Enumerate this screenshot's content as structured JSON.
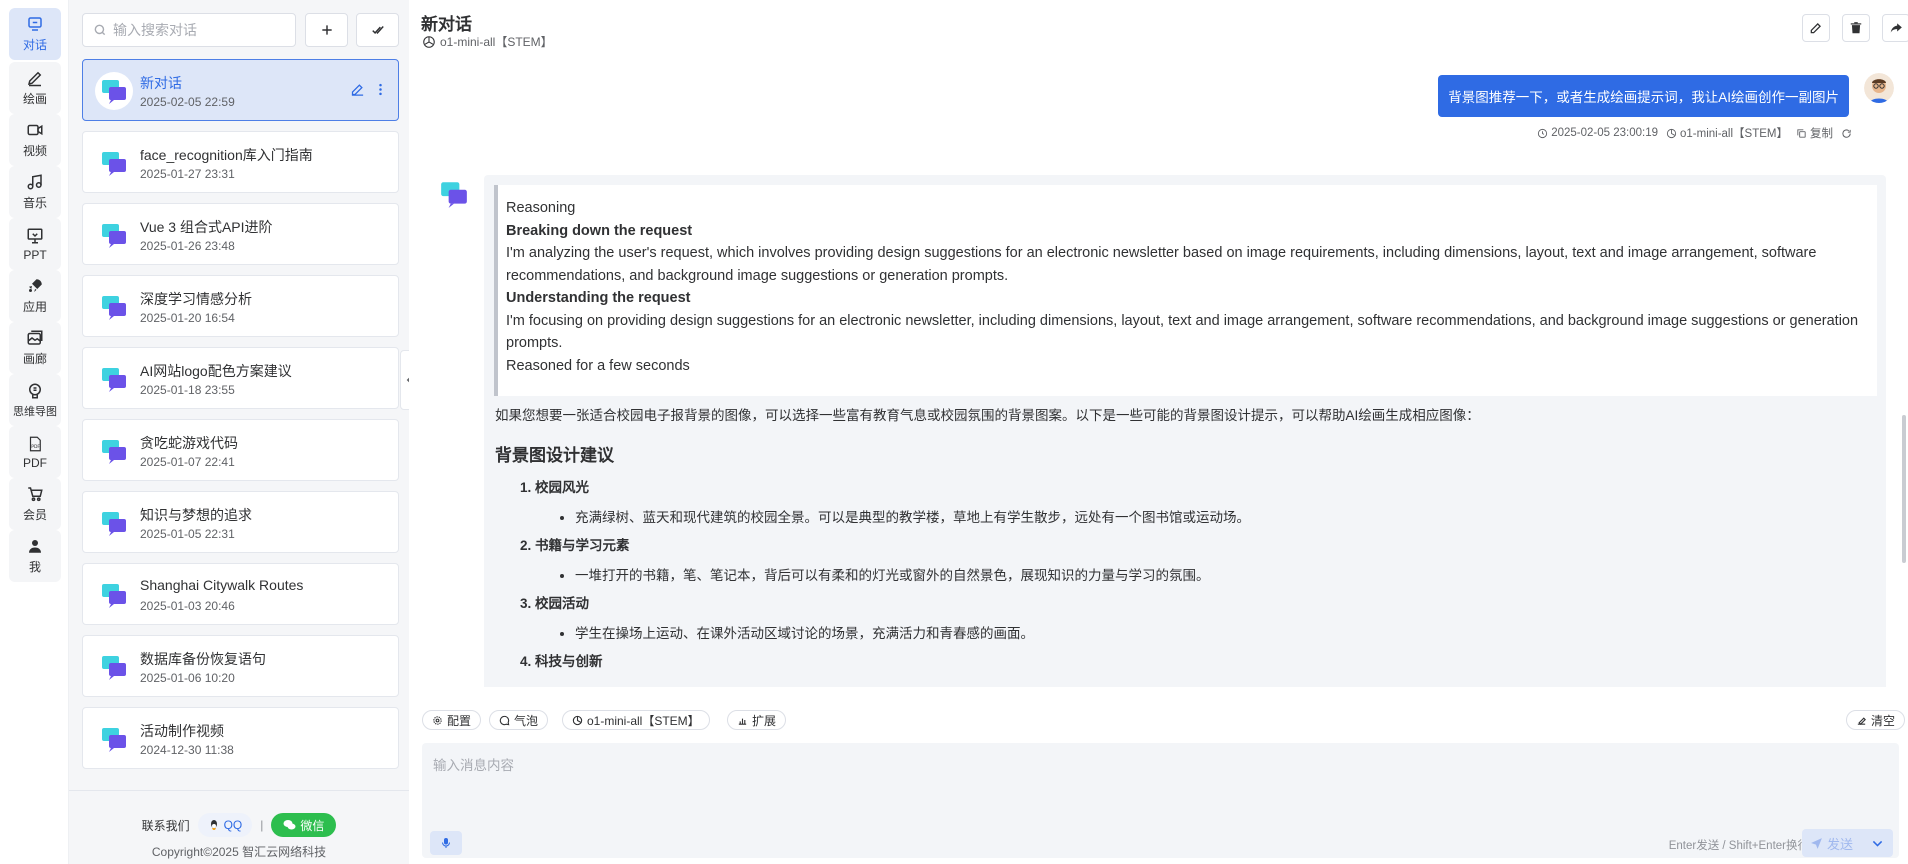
{
  "nav": [
    {
      "label": "对话",
      "icon": "chat-icon",
      "active": true
    },
    {
      "label": "绘画",
      "icon": "pen-icon"
    },
    {
      "label": "视频",
      "icon": "video-icon"
    },
    {
      "label": "音乐",
      "icon": "music-icon"
    },
    {
      "label": "PPT",
      "icon": "presentation-icon"
    },
    {
      "label": "应用",
      "icon": "rocket-icon"
    },
    {
      "label": "画廊",
      "icon": "gallery-icon"
    },
    {
      "label": "思维导图",
      "icon": "mindmap-icon"
    },
    {
      "label": "PDF",
      "icon": "pdf-icon"
    },
    {
      "label": "会员",
      "icon": "cart-icon"
    },
    {
      "label": "我",
      "icon": "user-icon"
    }
  ],
  "sidebar": {
    "search_placeholder": "输入搜索对话",
    "conversations": [
      {
        "title": "新对话",
        "date": "2025-02-05 22:59",
        "active": true
      },
      {
        "title": "face_recognition库入门指南",
        "date": "2025-01-27 23:31"
      },
      {
        "title": "Vue 3 组合式API进阶",
        "date": "2025-01-26 23:48"
      },
      {
        "title": "深度学习情感分析",
        "date": "2025-01-20 16:54"
      },
      {
        "title": "AI网站logo配色方案建议",
        "date": "2025-01-18 23:55"
      },
      {
        "title": "贪吃蛇游戏代码",
        "date": "2025-01-07 22:41"
      },
      {
        "title": "知识与梦想的追求",
        "date": "2025-01-05 22:31"
      },
      {
        "title": "Shanghai Citywalk Routes",
        "date": "2025-01-03 20:46"
      },
      {
        "title": "数据库备份恢复语句",
        "date": "2025-01-06 10:20"
      },
      {
        "title": "活动制作视频",
        "date": "2024-12-30 11:38"
      }
    ],
    "footer": {
      "contact_label": "联系我们",
      "qq_label": "QQ",
      "separator": "|",
      "wechat_label": "微信",
      "copyright": "Copyright©2025 智汇云网络科技"
    }
  },
  "header": {
    "title": "新对话",
    "model": "o1-mini-all【STEM】"
  },
  "messages": {
    "user": {
      "text": "背景图推荐一下，或者生成绘画提示词，我让AI绘画创作一副图片",
      "time": "2025-02-05 23:00:19",
      "model": "o1-mini-all【STEM】",
      "copy_label": "复制"
    },
    "bot": {
      "reasoning": {
        "label": "Reasoning",
        "h1": "Breaking down the request",
        "p1": "I'm analyzing the user's request, which involves providing design suggestions for an electronic newsletter based on image requirements, including dimensions, layout, text and image arrangement, software recommendations, and background image suggestions or generation prompts.",
        "h2": "Understanding the request",
        "p2": "I'm focusing on providing design suggestions for an electronic newsletter, including dimensions, layout, text and image arrangement, software recommendations, and background image suggestions or generation prompts.",
        "footer": "Reasoned for a few seconds"
      },
      "intro": "如果您想要一张适合校园电子报背景的图像，可以选择一些富有教育气息或校园氛围的背景图案。以下是一些可能的背景图设计提示，可以帮助AI绘画生成相应图像：",
      "heading": "背景图设计建议",
      "items": [
        {
          "title": "校园风光",
          "detail": "充满绿树、蓝天和现代建筑的校园全景。可以是典型的教学楼，草地上有学生散步，远处有一个图书馆或运动场。"
        },
        {
          "title": "书籍与学习元素",
          "detail": "一堆打开的书籍，笔、笔记本，背后可以有柔和的灯光或窗外的自然景色，展现知识的力量与学习的氛围。"
        },
        {
          "title": "校园活动",
          "detail": "学生在操场上运动、在课外活动区域讨论的场景，充满活力和青春感的画面。"
        },
        {
          "title": "科技与创新",
          "detail": ""
        }
      ]
    }
  },
  "toolbar": {
    "config_label": "配置",
    "bubble_label": "气泡",
    "model_label": "o1-mini-all【STEM】",
    "extend_label": "扩展",
    "clear_label": "清空"
  },
  "input": {
    "placeholder": "输入消息内容",
    "hint": "Enter发送 / Shift+Enter换行",
    "send_label": "发送"
  },
  "colors": {
    "accent": "#2f6be4",
    "wechat": "#2dbe4e"
  }
}
